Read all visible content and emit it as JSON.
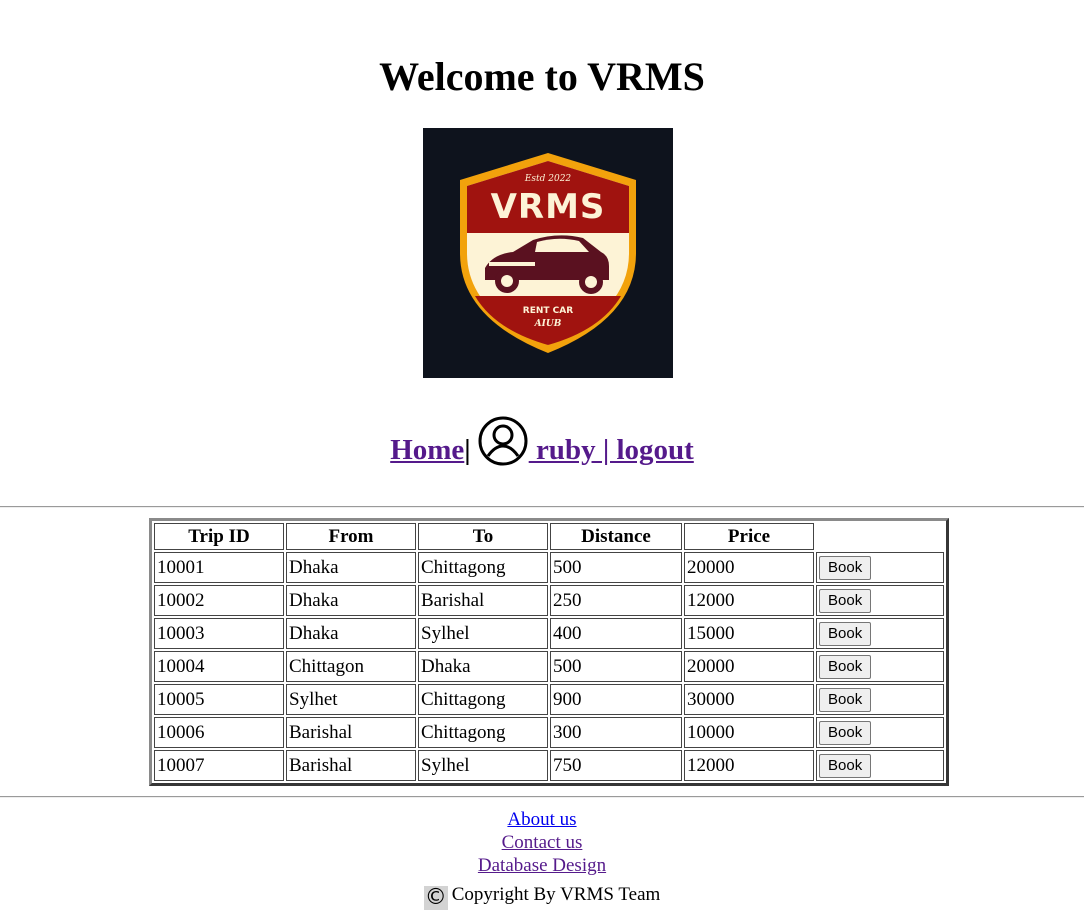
{
  "page": {
    "title": "Welcome to VRMS"
  },
  "logo": {
    "established": "Estd 2022",
    "brand": "VRMS",
    "line1": "RENT CAR",
    "line2": "AIUB",
    "colors": {
      "background": "#0e131d",
      "shield_border": "#f2a20c",
      "shield_red": "#a0130f",
      "shield_cream": "#fdf3d6"
    }
  },
  "nav": {
    "home": "Home",
    "separator": "|",
    "user": " ruby | logout",
    "icon": "user-circle-icon"
  },
  "table": {
    "headers": [
      "Trip ID",
      "From",
      "To",
      "Distance",
      "Price",
      ""
    ],
    "rows": [
      {
        "id": "10001",
        "from": "Dhaka",
        "to": "Chittagong",
        "distance": "500",
        "price": "20000",
        "action": "Book"
      },
      {
        "id": "10002",
        "from": "Dhaka",
        "to": "Barishal",
        "distance": "250",
        "price": "12000",
        "action": "Book"
      },
      {
        "id": "10003",
        "from": "Dhaka",
        "to": "Sylhel",
        "distance": "400",
        "price": "15000",
        "action": "Book"
      },
      {
        "id": "10004",
        "from": "Chittagon",
        "to": "Dhaka",
        "distance": "500",
        "price": "20000",
        "action": "Book"
      },
      {
        "id": "10005",
        "from": "Sylhet",
        "to": "Chittagong",
        "distance": "900",
        "price": "30000",
        "action": "Book"
      },
      {
        "id": "10006",
        "from": "Barishal",
        "to": "Chittagong",
        "distance": "300",
        "price": "10000",
        "action": "Book"
      },
      {
        "id": "10007",
        "from": "Barishal",
        "to": "Sylhel",
        "distance": "750",
        "price": "12000",
        "action": "Book"
      }
    ]
  },
  "footer": {
    "about": "About us",
    "contact": "Contact us",
    "database": "Database Design",
    "copyright_symbol": "©",
    "copyright": "Copyright By VRMS Team"
  }
}
